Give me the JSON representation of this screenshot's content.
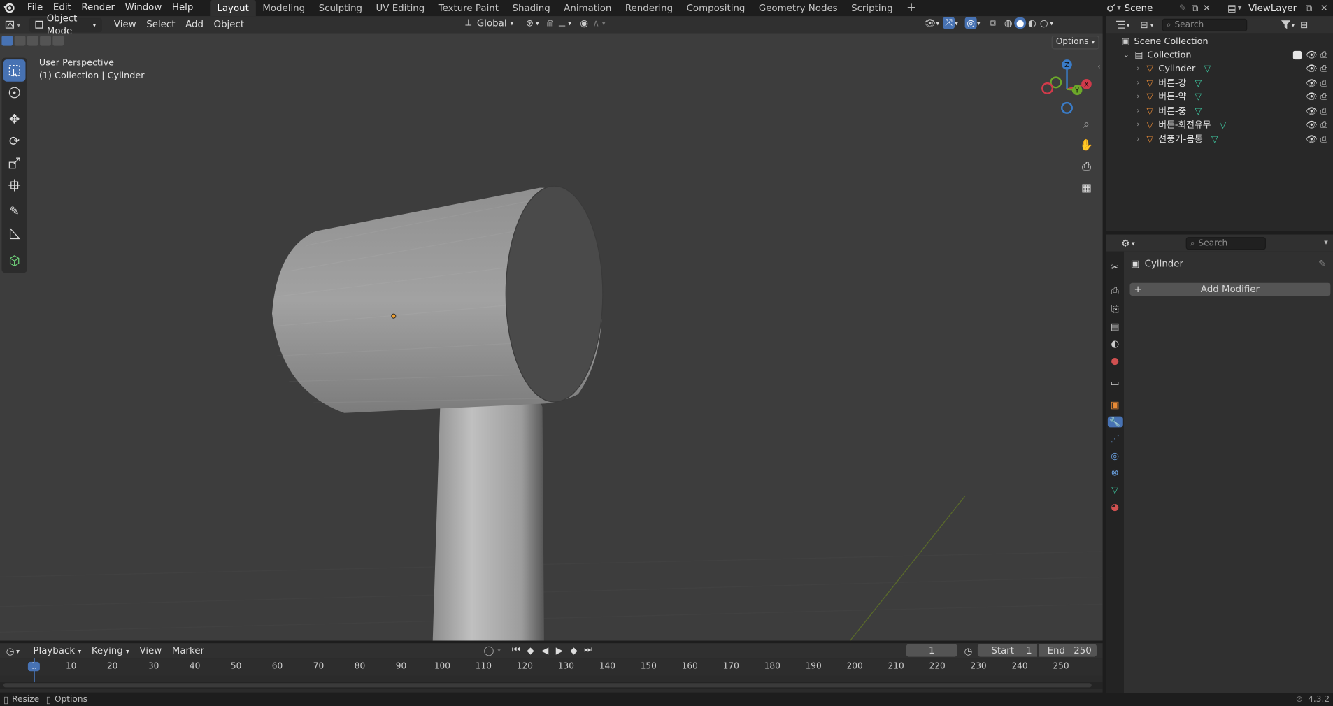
{
  "topbar": {
    "menus": [
      "File",
      "Edit",
      "Render",
      "Window",
      "Help"
    ],
    "workspaces": [
      "Layout",
      "Modeling",
      "Sculpting",
      "UV Editing",
      "Texture Paint",
      "Shading",
      "Animation",
      "Rendering",
      "Compositing",
      "Geometry Nodes",
      "Scripting"
    ],
    "active_workspace": "Layout",
    "scene_name": "Scene",
    "view_layer": "ViewLayer"
  },
  "viewport_header": {
    "mode": "Object Mode",
    "menus": [
      "View",
      "Select",
      "Add",
      "Object"
    ],
    "orientation": "Global",
    "options_label": "Options"
  },
  "viewport": {
    "perspective_label": "User Perspective",
    "collection_label": "(1) Collection | Cylinder",
    "gizmo_axes": [
      "Z",
      "Y",
      "X"
    ]
  },
  "outliner": {
    "search_placeholder": "Search",
    "root": "Scene Collection",
    "collection": "Collection",
    "objects": [
      "Cylinder",
      "버튼-강",
      "버튼-약",
      "버튼-중",
      "버튼-회전유무",
      "선풍기-몸통"
    ]
  },
  "properties": {
    "search_placeholder": "Search",
    "object_name": "Cylinder",
    "add_modifier_label": "Add Modifier"
  },
  "timeline": {
    "menus": [
      "Playback",
      "Keying",
      "View",
      "Marker"
    ],
    "current_frame": "1",
    "start_label": "Start",
    "start_value": "1",
    "end_label": "End",
    "end_value": "250",
    "ticks": [
      "1",
      "10",
      "20",
      "30",
      "40",
      "50",
      "60",
      "70",
      "80",
      "90",
      "100",
      "110",
      "120",
      "130",
      "140",
      "150",
      "160",
      "170",
      "180",
      "190",
      "200",
      "210",
      "220",
      "230",
      "240",
      "250"
    ]
  },
  "statusbar": {
    "left_items": [
      "Resize",
      "Options"
    ],
    "version": "4.3.2"
  },
  "colors": {
    "accent": "#4772b3",
    "viewport_bg": "#3d3d3d",
    "panel_bg": "#303030",
    "object_orange": "#e88a36",
    "mesh_green": "#3ec7a0"
  }
}
